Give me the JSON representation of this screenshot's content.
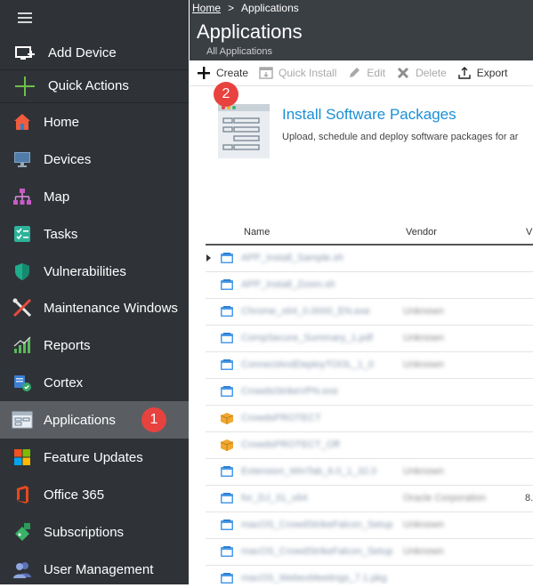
{
  "sidebar": {
    "top_actions": [
      {
        "label": "Add Device",
        "icon": "add-device-icon"
      },
      {
        "label": "Quick Actions",
        "icon": "quick-actions-plus-icon"
      }
    ],
    "items": [
      {
        "label": "Home",
        "icon": "home-icon"
      },
      {
        "label": "Devices",
        "icon": "monitor-icon"
      },
      {
        "label": "Map",
        "icon": "network-map-icon"
      },
      {
        "label": "Tasks",
        "icon": "tasks-checklist-icon"
      },
      {
        "label": "Vulnerabilities",
        "icon": "shield-icon"
      },
      {
        "label": "Maintenance Windows",
        "icon": "tools-icon"
      },
      {
        "label": "Reports",
        "icon": "bar-chart-icon"
      },
      {
        "label": "Cortex",
        "icon": "cortex-icon"
      },
      {
        "label": "Applications",
        "icon": "applications-icon",
        "active": true
      },
      {
        "label": "Feature Updates",
        "icon": "windows-logo-icon"
      },
      {
        "label": "Office 365",
        "icon": "office-logo-icon"
      },
      {
        "label": "Subscriptions",
        "icon": "subscriptions-icon"
      },
      {
        "label": "User Management",
        "icon": "users-icon"
      }
    ]
  },
  "callouts": {
    "one": "1",
    "two": "2"
  },
  "breadcrumb": {
    "home": "Home",
    "separator": ">",
    "current": "Applications"
  },
  "header": {
    "title": "Applications",
    "subtitle": "All Applications"
  },
  "toolbar": {
    "create": "Create",
    "quick_install": "Quick Install",
    "edit": "Edit",
    "delete": "Delete",
    "export": "Export"
  },
  "install": {
    "title": "Install Software Packages",
    "description": "Upload, schedule and deploy software packages for ar"
  },
  "table": {
    "headers": {
      "name": "Name",
      "vendor": "Vendor",
      "version": "V"
    },
    "rows": [
      {
        "name": "APP_Install_Sample.sh",
        "vendor": "",
        "version": "",
        "icon": "package-blue"
      },
      {
        "name": "APP_Install_Zoom.sh",
        "vendor": "",
        "version": "",
        "icon": "package-blue"
      },
      {
        "name": "Chrome_x64_0.0000_EN.exe",
        "vendor": "Unknown",
        "version": "",
        "icon": "package-blue"
      },
      {
        "name": "CompSecure_Summary_1.pdf",
        "vendor": "Unknown",
        "version": "",
        "icon": "package-blue"
      },
      {
        "name": "ConnectAndDeployTOOL_1_0",
        "vendor": "Unknown",
        "version": "",
        "icon": "package-blue"
      },
      {
        "name": "CrowdsStrikeVPN.exe",
        "vendor": "",
        "version": "",
        "icon": "package-blue"
      },
      {
        "name": "CrowdsPROTECT",
        "vendor": "",
        "version": "",
        "icon": "package-box"
      },
      {
        "name": "CrowdsPROTECT_Off",
        "vendor": "",
        "version": "",
        "icon": "package-box"
      },
      {
        "name": "Extension_WinTab_6.0_1_32.0",
        "vendor": "Unknown",
        "version": "",
        "icon": "package-blue"
      },
      {
        "name": "for_DJ_31_x64",
        "vendor": "Oracle Corporation",
        "version": "8.",
        "icon": "package-blue"
      },
      {
        "name": "macOS_CrowdStrikeFalcon_Setup",
        "vendor": "Unknown",
        "version": "",
        "icon": "package-blue"
      },
      {
        "name": "macOS_CrowdStrikeFalcon_Setup",
        "vendor": "Unknown",
        "version": "",
        "icon": "package-blue"
      },
      {
        "name": "macOS_WebexMeetings_7.1.pkg",
        "vendor": "",
        "version": "",
        "icon": "package-blue"
      }
    ]
  },
  "colors": {
    "sidebar_bg": "#2f3338",
    "sidebar_active": "#5a5e63",
    "header_bg": "#3a3f44",
    "accent": "#1a8fd6",
    "callout": "#e8423f"
  }
}
